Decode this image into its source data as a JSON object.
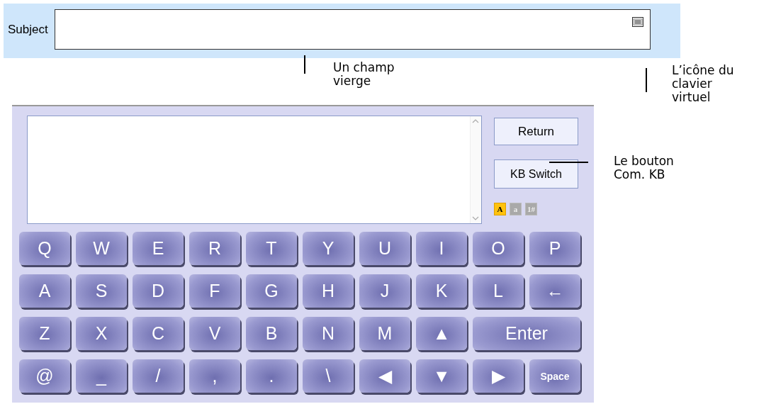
{
  "subject_bar": {
    "label": "Subject"
  },
  "annotations": [
    {
      "kind": "vline",
      "text": "Un champ\nvierge"
    },
    {
      "kind": "vline",
      "text": "L’icône du\nclavier\nvirtuel"
    },
    {
      "kind": "hline",
      "text": "Le bouton\nCom. KB"
    }
  ],
  "keyboard": {
    "buttons": [
      "Return",
      "KB Switch"
    ],
    "modes": [
      {
        "label": "A",
        "selected": true
      },
      {
        "label": "a",
        "selected": false
      },
      {
        "label": "1#",
        "selected": false
      }
    ],
    "rows": [
      [
        {
          "label": "Q",
          "kind": "key"
        },
        {
          "label": "W",
          "kind": "key"
        },
        {
          "label": "E",
          "kind": "key"
        },
        {
          "label": "R",
          "kind": "key"
        },
        {
          "label": "T",
          "kind": "key"
        },
        {
          "label": "Y",
          "kind": "key"
        },
        {
          "label": "U",
          "kind": "key"
        },
        {
          "label": "I",
          "kind": "key"
        },
        {
          "label": "O",
          "kind": "key"
        },
        {
          "label": "P",
          "kind": "key"
        }
      ],
      [
        {
          "label": "A",
          "kind": "key"
        },
        {
          "label": "S",
          "kind": "key"
        },
        {
          "label": "D",
          "kind": "key"
        },
        {
          "label": "F",
          "kind": "key"
        },
        {
          "label": "G",
          "kind": "key"
        },
        {
          "label": "H",
          "kind": "key"
        },
        {
          "label": "J",
          "kind": "key"
        },
        {
          "label": "K",
          "kind": "key"
        },
        {
          "label": "L",
          "kind": "key"
        },
        {
          "label": "←",
          "kind": "key"
        }
      ],
      [
        {
          "label": "Z",
          "kind": "key"
        },
        {
          "label": "X",
          "kind": "key"
        },
        {
          "label": "C",
          "kind": "key"
        },
        {
          "label": "V",
          "kind": "key"
        },
        {
          "label": "B",
          "kind": "key"
        },
        {
          "label": "N",
          "kind": "key"
        },
        {
          "label": "M",
          "kind": "key"
        },
        {
          "label": "▲",
          "kind": "key"
        },
        {
          "label": "Enter",
          "kind": "wide"
        }
      ],
      [
        {
          "label": "@",
          "kind": "key"
        },
        {
          "label": "_",
          "kind": "key"
        },
        {
          "label": "/",
          "kind": "key"
        },
        {
          "label": ",",
          "kind": "key"
        },
        {
          "label": ".",
          "kind": "key"
        },
        {
          "label": "\\",
          "kind": "key"
        },
        {
          "label": "◀",
          "kind": "key"
        },
        {
          "label": "▼",
          "kind": "key"
        },
        {
          "label": "▶",
          "kind": "key"
        },
        {
          "label": "Space",
          "kind": "small"
        }
      ]
    ]
  }
}
